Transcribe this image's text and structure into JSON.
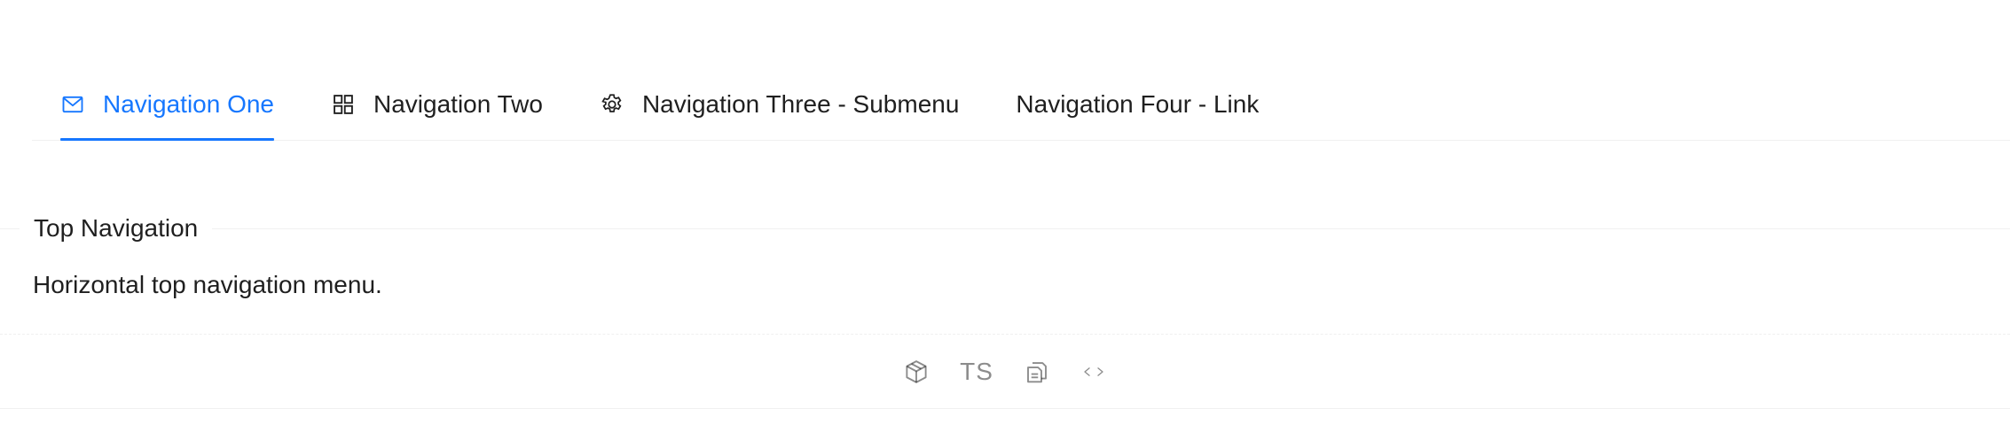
{
  "menu": {
    "items": [
      {
        "label": "Navigation One",
        "icon": "mail-icon",
        "active": true
      },
      {
        "label": "Navigation Two",
        "icon": "appstore-icon",
        "active": false
      },
      {
        "label": "Navigation Three - Submenu",
        "icon": "setting-icon",
        "active": false
      },
      {
        "label": "Navigation Four - Link",
        "icon": null,
        "active": false
      }
    ],
    "accent_color": "#1677ff"
  },
  "meta": {
    "title": "Top Navigation",
    "description": "Horizontal top navigation menu."
  },
  "actions": {
    "ts_label": "TS",
    "icons": [
      "codesandbox-icon",
      "ts-toggle",
      "copy-icon",
      "code-expand-icon"
    ]
  }
}
